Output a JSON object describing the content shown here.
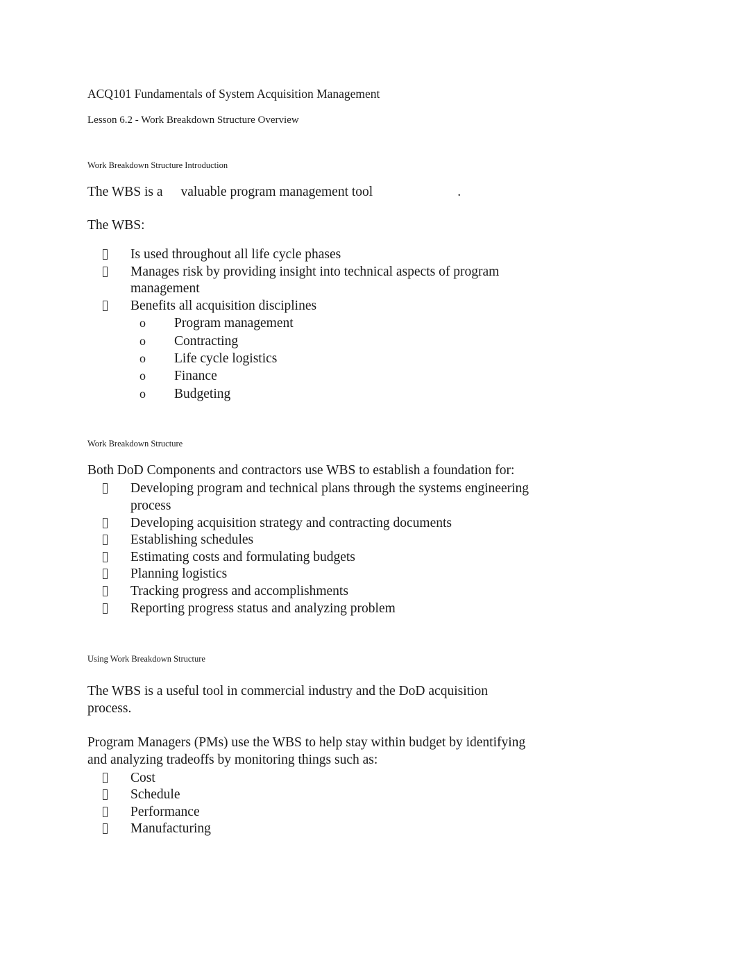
{
  "document": {
    "title": "ACQ101 Fundamentals of System Acquisition Management",
    "subtitle": "Lesson 6.2 - Work Breakdown Structure Overview"
  },
  "sections": [
    {
      "heading": "Work Breakdown Structure Introduction",
      "intro_before_blank": "The WBS is a",
      "intro_after_blank": "valuable program management tool",
      "intro_end": ".",
      "lead_in": "The WBS:",
      "bullets": [
        "Is used throughout all life cycle phases",
        "Manages risk by providing insight into technical aspects of program management",
        "Benefits all acquisition disciplines"
      ],
      "sub_bullets": [
        "Program management",
        "Contracting",
        "Life cycle logistics",
        "Finance",
        "Budgeting"
      ]
    },
    {
      "heading": "Work Breakdown Structure",
      "lead_in": "Both DoD Components and contractors use WBS to establish a foundation for:",
      "bullets": [
        "Developing program and technical plans through the systems engineering process",
        "Developing acquisition strategy and contracting documents",
        "Establishing schedules",
        "Estimating costs and formulating budgets",
        "Planning logistics",
        "Tracking progress and accomplishments",
        "Reporting progress status and analyzing problem"
      ]
    },
    {
      "heading": "Using Work Breakdown Structure",
      "para_1": "The WBS is a useful tool in commercial industry and the DoD acquisition process.",
      "para_2": "Program Managers (PMs) use the WBS to help stay within budget by identifying and analyzing tradeoffs by monitoring things such as:",
      "bullets": [
        "Cost",
        "Schedule",
        "Performance",
        "Manufacturing"
      ]
    }
  ],
  "markers": {
    "sub_bullet_glyph": "o"
  },
  "colors": {
    "page_background": "#ffffff",
    "text": "#1a1a1a",
    "bullet_box_outline": "#3b3b3b"
  }
}
